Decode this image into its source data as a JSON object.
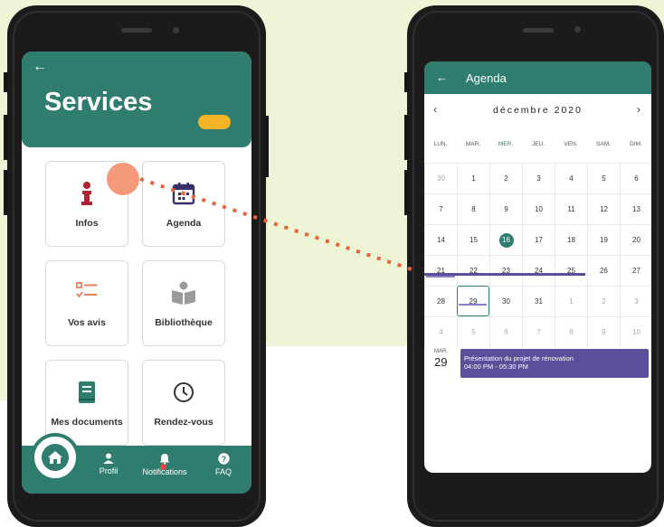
{
  "colors": {
    "primary": "#2f7d6e",
    "accent": "#f6b428",
    "highlight": "#f59a78",
    "event": "#5b4f9b",
    "danger": "#e04848"
  },
  "services": {
    "back_icon": "←",
    "title": "Services",
    "tiles": [
      {
        "label": "Infos",
        "icon": "info-icon"
      },
      {
        "label": "Agenda",
        "icon": "calendar-icon"
      },
      {
        "label": "Vos avis",
        "icon": "checklist-icon"
      },
      {
        "label": "Bibliothèque",
        "icon": "library-icon"
      },
      {
        "label": "Mes documents",
        "icon": "book-icon"
      },
      {
        "label": "Rendez-vous",
        "icon": "clock-icon"
      }
    ],
    "nav": [
      {
        "label": "Profil",
        "icon": "person-icon"
      },
      {
        "label": "Notifications",
        "icon": "bell-icon"
      },
      {
        "label": "FAQ",
        "icon": "help-icon"
      }
    ]
  },
  "agenda": {
    "back_icon": "←",
    "title": "Agenda",
    "month": "décembre 2020",
    "prev": "‹",
    "next": "›",
    "weekdays": [
      "LUN.",
      "MAR.",
      "MER.",
      "JEU.",
      "VEN.",
      "SAM.",
      "DIM."
    ],
    "weeks": [
      [
        "30",
        "1",
        "2",
        "3",
        "4",
        "5",
        "6"
      ],
      [
        "7",
        "8",
        "9",
        "10",
        "11",
        "12",
        "13"
      ],
      [
        "14",
        "15",
        "16",
        "17",
        "18",
        "19",
        "20"
      ],
      [
        "21",
        "22",
        "23",
        "24",
        "25",
        "26",
        "27"
      ],
      [
        "28",
        "29",
        "30",
        "31",
        "1",
        "2",
        "3"
      ],
      [
        "4",
        "5",
        "6",
        "7",
        "8",
        "9",
        "10"
      ]
    ],
    "today": "16",
    "selected": "29",
    "event": {
      "dow": "MAR.",
      "day": "29",
      "title": "Présentation du projet de rénovation",
      "time": "04:00 PM - 05:30 PM"
    }
  }
}
